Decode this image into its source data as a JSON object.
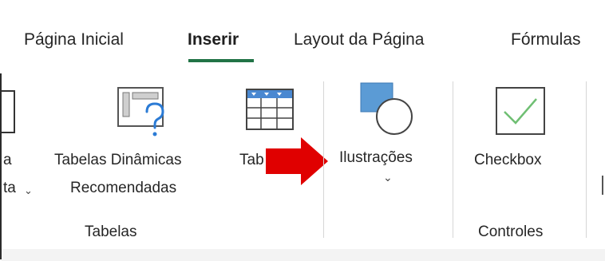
{
  "tabs": {
    "home": "Página Inicial",
    "insert": "Inserir",
    "layout": "Layout da Página",
    "formulas": "Fórmulas"
  },
  "ribbon": {
    "left_partial_line1": "a",
    "left_partial_line2": "ta",
    "rec_pivot_line1": "Tabelas Dinâmicas",
    "rec_pivot_line2": "Recomendadas",
    "table_partial": "Tab",
    "illustrations": "Ilustrações",
    "checkbox": "Checkbox",
    "groups": {
      "tables": "Tabelas",
      "controls": "Controles"
    }
  },
  "colors": {
    "accent_green": "#217346",
    "arrow_red": "#e00000",
    "shape_blue": "#5b9bd5",
    "check_green": "#6fbf73"
  }
}
